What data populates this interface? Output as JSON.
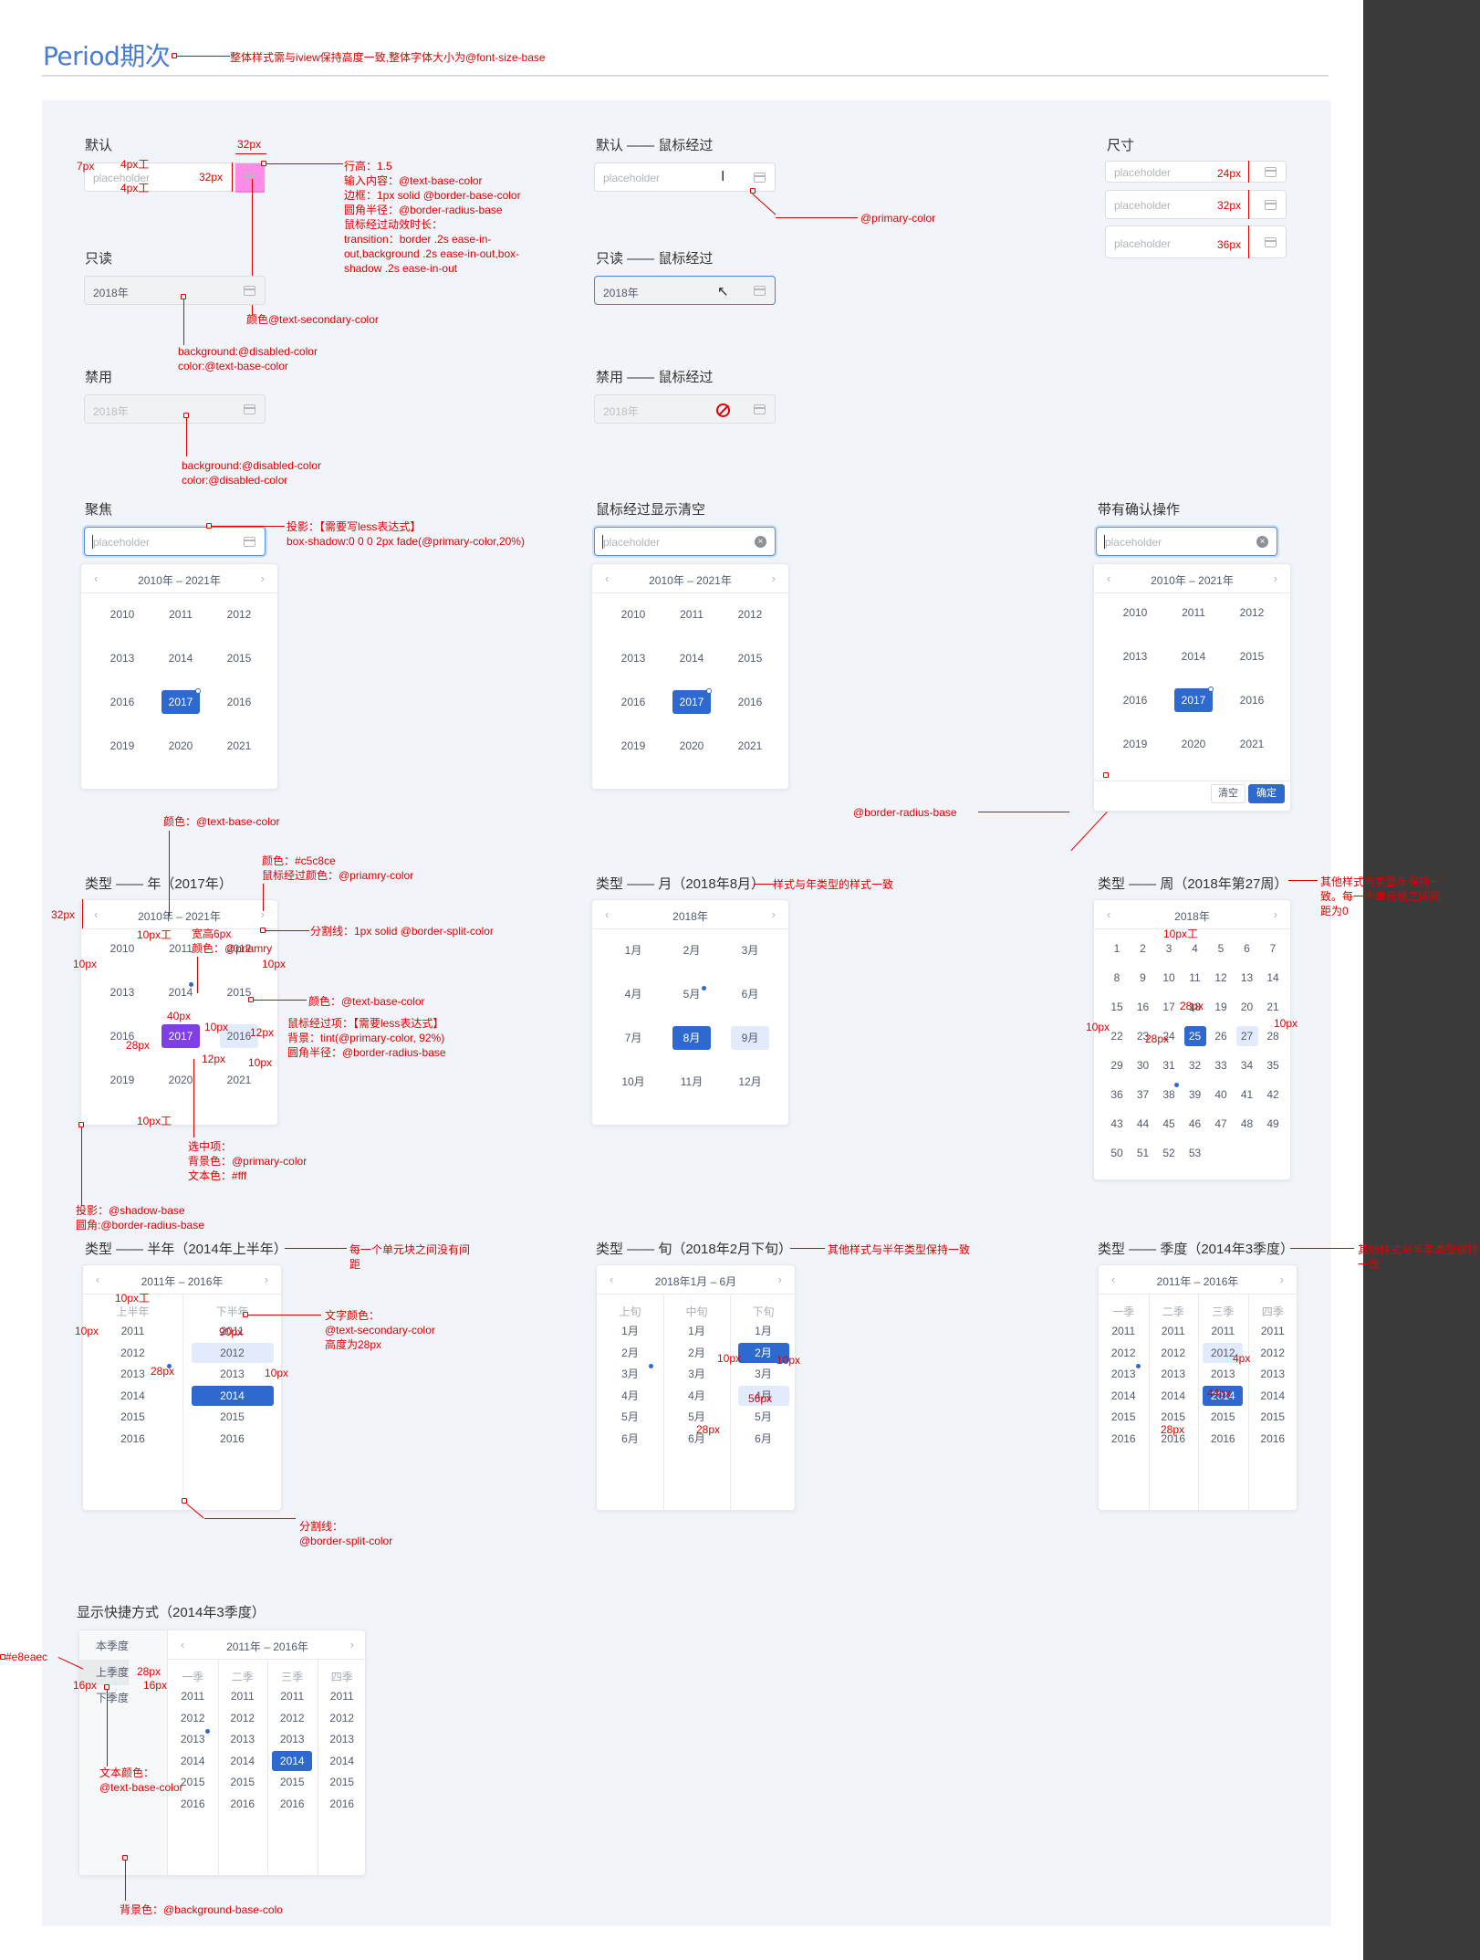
{
  "page": {
    "title": "Period期次",
    "title_note": "整体样式需与iview保持高度一致,整体字体大小为@font-size-base"
  },
  "colors": {
    "primary": "#2d69cf",
    "annotation": "#e10000",
    "canvas": "#f1f4f9"
  },
  "sections": {
    "default": "默认",
    "default_hover": "默认 —— 鼠标经过",
    "size": "尺寸",
    "readonly": "只读",
    "readonly_hover": "只读 —— 鼠标经过",
    "disabled": "禁用",
    "disabled_hover": "禁用 —— 鼠标经过",
    "focus": "聚焦",
    "hover_clear": "鼠标经过显示清空",
    "confirm": "带有确认操作",
    "type_year": "类型 —— 年（2017年）",
    "type_month": "类型 —— 月（2018年8月）",
    "type_week": "类型 —— 周（2018年第27周）",
    "type_half": "类型 —— 半年（2014年上半年）",
    "type_xun": "类型 —— 旬（2018年2月下旬）",
    "type_quarter": "类型 —— 季度（2014年3季度）",
    "shortcut": "显示快捷方式（2014年3季度）"
  },
  "inputs": {
    "placeholder": "placeholder",
    "value": "2018年"
  },
  "year_panel": {
    "range": "2010年 – 2021年",
    "years": [
      "2010",
      "2011",
      "2012",
      "2013",
      "2014",
      "2015",
      "2016",
      "2017",
      "2016",
      "2019",
      "2020",
      "2021"
    ]
  },
  "confirm_buttons": {
    "clear": "清空",
    "ok": "确定"
  },
  "month_panel": {
    "year": "2018年",
    "months": [
      "1月",
      "2月",
      "3月",
      "4月",
      "5月",
      "6月",
      "7月",
      "8月",
      "9月",
      "10月",
      "11月",
      "12月"
    ]
  },
  "week_panel": {
    "year": "2018年",
    "weeks": [
      "1",
      "2",
      "3",
      "4",
      "5",
      "6",
      "7",
      "8",
      "9",
      "10",
      "11",
      "12",
      "13",
      "14",
      "15",
      "16",
      "17",
      "18",
      "19",
      "20",
      "21",
      "22",
      "23",
      "24",
      "25",
      "26",
      "27",
      "28",
      "29",
      "30",
      "31",
      "32",
      "33",
      "34",
      "35",
      "36",
      "37",
      "38",
      "39",
      "40",
      "41",
      "42",
      "43",
      "44",
      "45",
      "46",
      "47",
      "48",
      "49",
      "50",
      "51",
      "52",
      "53"
    ]
  },
  "half_panel": {
    "range": "2011年 – 2016年",
    "headers": [
      "上半年",
      "下半年"
    ],
    "years": [
      "2011",
      "2012",
      "2013",
      "2014",
      "2015",
      "2016"
    ]
  },
  "xun_panel": {
    "range": "2018年1月 – 6月",
    "headers": [
      "上旬",
      "中旬",
      "下旬"
    ],
    "months": [
      "1月",
      "2月",
      "3月",
      "4月",
      "5月",
      "6月"
    ]
  },
  "quarter_panel": {
    "range": "2011年 – 2016年",
    "headers": [
      "一季",
      "二季",
      "三季",
      "四季"
    ],
    "years": [
      "2011",
      "2012",
      "2013",
      "2014",
      "2015",
      "2016"
    ]
  },
  "shortcut_panel": {
    "options": [
      "本季度",
      "上季度",
      "下季度"
    ]
  },
  "annotations": {
    "px32a": "32px",
    "px7": "7px",
    "px4a": "4px工",
    "px4b": "4px工",
    "px32b": "32px",
    "spec1": [
      "行高：1.5",
      "输入内容：@text-base-color",
      "边框：1px solid @border-base-color",
      "圆角半径：@border-radius-base",
      "鼠标经过动效时长：",
      "transition：border .2s ease-in-",
      "out,background .2s ease-in-out,box-",
      "shadow .2s ease-in-out"
    ],
    "text_secondary": "颜色@text-secondary-color",
    "readonly_spec": [
      "background:@disabled-color",
      "color:@text-base-color"
    ],
    "disabled_spec": [
      "background:@disabled-color",
      "color:@disabled-color"
    ],
    "primary_color": "@primary-color",
    "size_24": "24px",
    "size_32": "32px",
    "size_36": "36px",
    "focus_spec": [
      "投影：【需要写less表达式】",
      "box-shadow:0 0 0 2px fade(@primary-color,20%)"
    ],
    "radius_base": "@border-radius-base",
    "year_color": "颜色：@text-base-color",
    "year_c5": [
      "颜色：#c5c8ce",
      "鼠标经过颜色：@priamry-color"
    ],
    "year_split": "分割线：1px solid @border-split-color",
    "year_32": "32px",
    "year_10a": "10px工",
    "year_dot": [
      "宽高6px",
      "颜色：@priamry"
    ],
    "year_10b": "10px",
    "year_10c": "10px",
    "year_text": "颜色：@text-base-color",
    "year_40": "40px",
    "year_28": "28px",
    "year_10d": "10px",
    "year_12a": "12px",
    "year_hover": [
      "鼠标经过项：【需要less表达式】",
      "背景：tint(@primary-color, 92%)",
      "圆角半径：@border-radius-base"
    ],
    "year_12b": "12px",
    "year_10e": "10px",
    "year_10f": "10px工",
    "year_selected": [
      "选中项：",
      "背景色：@primary-color",
      "文本色：#fff"
    ],
    "year_shadow": [
      "投影：@shadow-base",
      "圆角:@border-radius-base"
    ],
    "month_note": "样式与年类型的样式一致",
    "week_note": [
      "其他样式与类型年保持一",
      "致。每一个单元格之间间",
      "距为0"
    ],
    "week_10a": "10px工",
    "week_28a": "28px",
    "week_28b": "28px",
    "week_10b": "10px",
    "week_10c": "10px",
    "half_note": [
      "每一个单元块之间没有间",
      "距"
    ],
    "half_10a": "10px工",
    "half_10b": "10px",
    "half_90": "90px",
    "half_28": "28px",
    "half_10c": "10px",
    "half_text": [
      "文字颜色：",
      "@text-secondary-color",
      "高度为28px"
    ],
    "half_split": [
      "分割线：",
      "@border-split-color"
    ],
    "xun_note": "其他样式与半年类型保持一致",
    "xun_10a": "10px",
    "xun_10b": "10px",
    "xun_56": "56px",
    "xun_28": "28px",
    "quarter_note": [
      "其他样式与半年类型保持",
      "一致"
    ],
    "quarter_4": "4px",
    "quarter_44": "44px",
    "quarter_28": "28px",
    "sc_color": "#e8eaec",
    "sc_28": "28px",
    "sc_16a": "16px",
    "sc_16b": "16px",
    "sc_text": [
      "文本颜色：",
      "@text-base-color"
    ],
    "sc_bg": "背景色：@background-base-colo"
  }
}
